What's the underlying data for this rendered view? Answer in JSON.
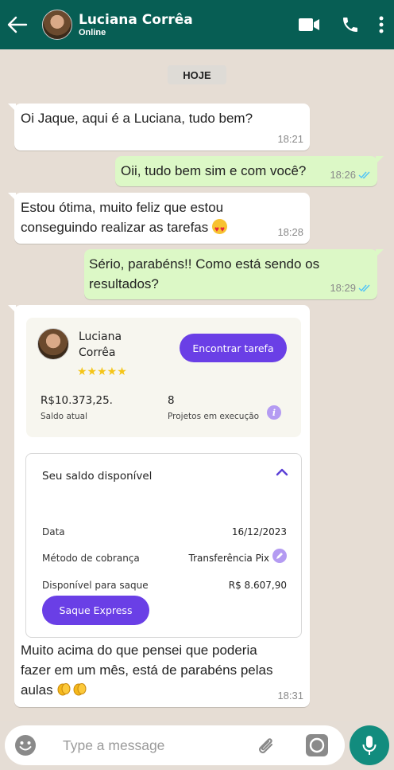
{
  "header": {
    "contact_name": "Luciana Corrêa",
    "status": "Online"
  },
  "chat": {
    "date_chip": "HOJE",
    "messages": [
      {
        "direction": "in",
        "text": "Oi Jaque, aqui é a Luciana, tudo bem?",
        "time": "18:21"
      },
      {
        "direction": "out",
        "text": "Oii, tudo bem sim e com você?",
        "time": "18:26",
        "status": "read"
      },
      {
        "direction": "in",
        "text_line1": "Estou ótima, muito feliz que estou",
        "text_line2": "conseguindo realizar as tarefas",
        "emoji": "heart-eyes-emoji",
        "time": "18:28"
      },
      {
        "direction": "out",
        "text_line1": "Sério, parabéns!! Como está sendo os",
        "text_line2": "resultados?",
        "time": "18:29",
        "status": "read"
      },
      {
        "direction": "in",
        "caption_line1": "Muito acima do que pensei que poderia",
        "caption_line2": "fazer em um mês, está de parabéns pelas",
        "caption_line3": "aulas",
        "emoji": "clapping-hands-emoji",
        "time": "18:31"
      }
    ]
  },
  "profile_card": {
    "name_line1": "Luciana",
    "name_line2": "Corrêa",
    "stars": "★★★★★",
    "rating": 5,
    "find_button": "Encontrar tarefa",
    "balance_value": "R$10.373,25.",
    "balance_label": "Saldo atual",
    "projects_value": "8",
    "projects_label": "Projetos em execução"
  },
  "balance_card": {
    "title": "Seu saldo disponível",
    "rows": [
      {
        "label": "Data",
        "value": "16/12/2023"
      },
      {
        "label": "Método de cobrança",
        "value": "Transferência Pix"
      },
      {
        "label": "Disponível para saque",
        "value": "R$ 8.607,90"
      }
    ],
    "button": "Saque Express"
  },
  "input": {
    "placeholder": "Type a message"
  },
  "colors": {
    "header": "#075e54",
    "chat_bg": "#e6ddd4",
    "outgoing_bubble": "#dcf8c6",
    "accent_purple": "#6a3fe6",
    "mic_button": "#128c7e",
    "read_tick": "#4fc3f7"
  }
}
